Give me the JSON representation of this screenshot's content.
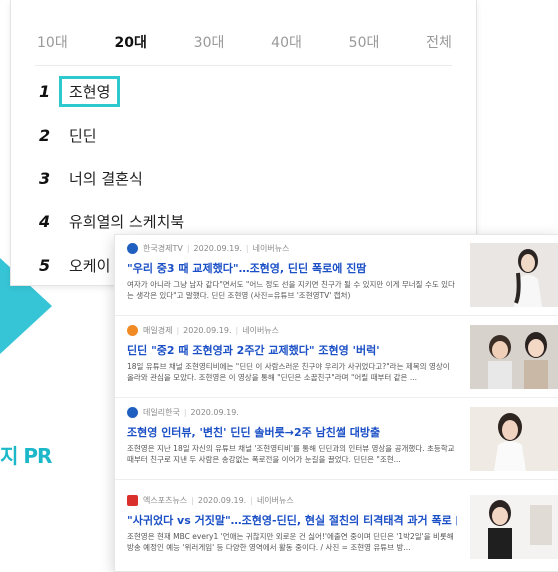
{
  "ranking": {
    "tabs": [
      "10대",
      "20대",
      "30대",
      "40대",
      "50대",
      "전체"
    ],
    "active_tab": "20대",
    "items": [
      {
        "rank": "1",
        "label": "조현영"
      },
      {
        "rank": "2",
        "label": "딘딘"
      },
      {
        "rank": "3",
        "label": "너의 결혼식"
      },
      {
        "rank": "4",
        "label": "유희열의 스케치북"
      },
      {
        "rank": "5",
        "label": "오케이 마"
      }
    ]
  },
  "side_text": "지 PR",
  "colors": {
    "accent": "#2ec8cf",
    "link": "#1a4fc6"
  },
  "news": [
    {
      "source": "한국경제TV",
      "date": "2020.09.19.",
      "platform": "네이버뉴스",
      "title": "\"우리 중3 때 교제했다\"…조현영, 딘딘 폭로에 진땀",
      "desc": "여자가 아니라 그냥 남자 같다\"면서도 \"어느 정도 선을 지키면 친구가 될 수 있지만 이게 무너질 수도 있다는 생각은 있다\"고 말했다. 딘딘 조현영 (사진=유튜브 '조현영TV' 캡처)",
      "logo_color": "#1f5fc0"
    },
    {
      "source": "매일경제",
      "date": "2020.09.19.",
      "platform": "네이버뉴스",
      "title": "딘딘 \"중2 때 조현영과 2주간 교제했다\" 조현영 '버럭'",
      "desc": "18일 유튜브 채널 조현영티비에는 \"딘딘 이 사람스러운 친구야 우리가 사귀었다고?\"라는 제목의 영상이 올라와 관심을 모았다. 조현영은 이 영상을 통해 \"딘딘은 소꿉친구\"라며 \"어릴 때부터 같은 ...",
      "logo_color": "#f08a24"
    },
    {
      "source": "데일리한국",
      "date": "2020.09.19.",
      "platform": "",
      "title": "조현영 인터뷰, '변친' 딘딘 솔버릇→2주 남친썰 대방출",
      "desc": "조현영은 지난 18일 자신의 유튜브 채널 '조현영티비'를 통해 딘딘과의 인터뷰 영상을 공개했다. 초등학교 때부터 친구로 지낸 두 사람은 송강없는 폭로전을 이어가 눈길을 끌었다. 딘딘은 \"조현...",
      "logo_color": "#1f5fc0"
    },
    {
      "source": "엑스포츠뉴스",
      "date": "2020.09.19.",
      "platform": "네이버뉴스",
      "title": "\"사귀었다 vs 거짓말\"…조현영-딘딘, 현실 절친의 티격태격 과거 폭로 [종...",
      "desc": "조현영은 현재 MBC every1 '언애는 귀찮지만 외로운 건 싫어!'에출연 중이며 딘딘은 '1박2일'을 비롯해 방송 예정인 예능 '위러게임' 등 다양한 영역에서 활동 중이다. / 사진 = 조현영 유튜브 방...",
      "logo_color": "#d9302c"
    }
  ],
  "thumb_caption": "과거 대방출"
}
